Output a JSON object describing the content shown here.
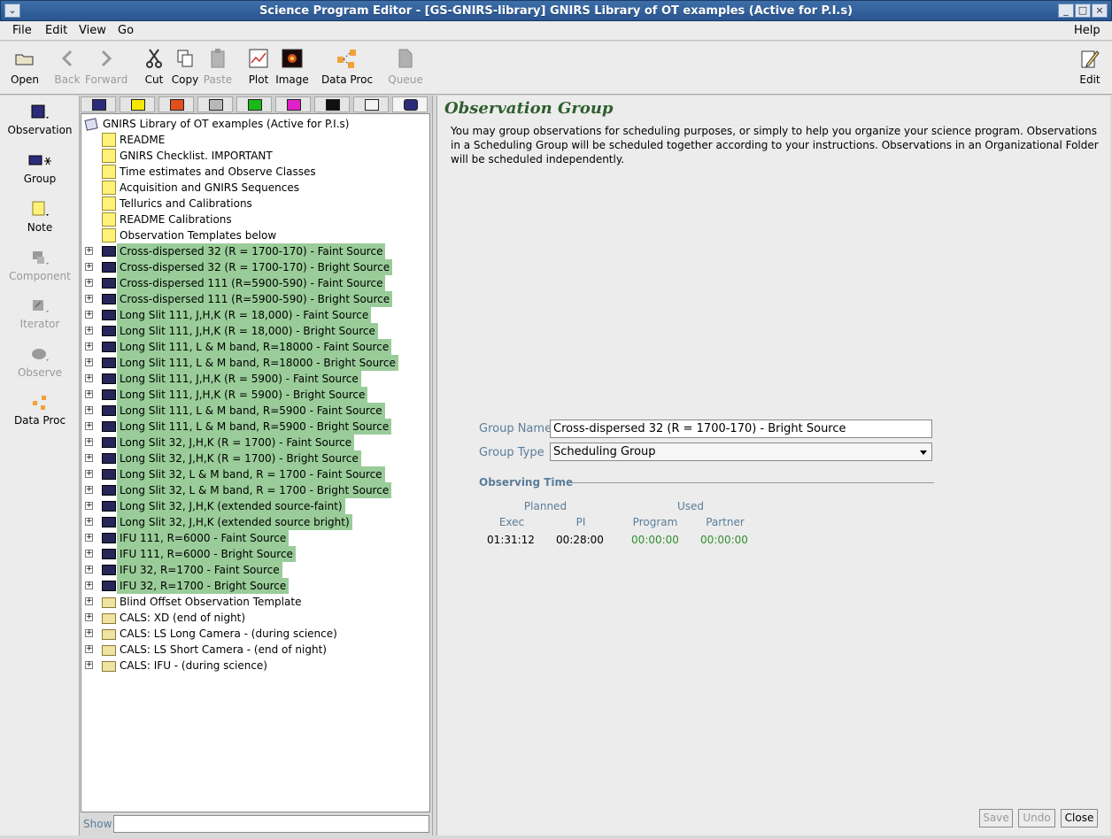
{
  "window": {
    "title": "Science Program Editor - [GS-GNIRS-library] GNIRS Library of OT examples (Active for P.I.s)"
  },
  "menu": {
    "file": "File",
    "edit": "Edit",
    "view": "View",
    "go": "Go",
    "help": "Help"
  },
  "toolbar": {
    "open": "Open",
    "back": "Back",
    "forward": "Forward",
    "cut": "Cut",
    "copy": "Copy",
    "paste": "Paste",
    "plot": "Plot",
    "image": "Image",
    "data_proc": "Data Proc",
    "queue": "Queue",
    "edit": "Edit"
  },
  "left_panel": {
    "observation": "Observation",
    "group": "Group",
    "note": "Note",
    "component": "Component",
    "iterator": "Iterator",
    "observe": "Observe",
    "data_proc": "Data Proc"
  },
  "tree": {
    "root": "GNIRS Library of OT examples (Active for P.I.s)",
    "notes": [
      "README",
      "GNIRS Checklist.  IMPORTANT",
      "Time estimates and Observe Classes",
      "Acquisition and GNIRS Sequences",
      "Tellurics and Calibrations",
      "README Calibrations",
      "Observation Templates below"
    ],
    "groups": [
      "Cross-dispersed 32 (R = 1700-170) - Faint Source",
      "Cross-dispersed 32 (R = 1700-170) - Bright Source",
      "Cross-dispersed 111 (R=5900-590) - Faint Source",
      "Cross-dispersed 111 (R=5900-590) - Bright Source",
      "Long Slit 111,  J,H,K (R = 18,000) - Faint Source",
      "Long Slit 111,  J,H,K (R = 18,000) - Bright Source",
      "Long Slit 111,  L & M band, R=18000 - Faint Source",
      "Long Slit 111,  L & M band, R=18000 - Bright Source",
      "Long Slit 111,  J,H,K (R = 5900) - Faint Source",
      "Long Slit 111,  J,H,K (R = 5900) - Bright Source",
      "Long Slit 111,  L & M band, R=5900 - Faint Source",
      "Long Slit 111,  L & M band, R=5900 - Bright Source",
      "Long Slit 32,  J,H,K (R = 1700) - Faint Source",
      "Long Slit 32,  J,H,K (R = 1700) - Bright Source",
      "Long Slit 32,  L & M band, R = 1700 - Faint Source",
      "Long Slit 32,  L & M band, R = 1700 - Bright Source",
      "Long Slit 32, J,H,K (extended source-faint)",
      "Long Slit 32, J,H,K (extended source bright)",
      "IFU 111, R=6000 - Faint Source",
      "IFU 111, R=6000 - Bright Source",
      "IFU 32, R=1700 - Faint Source",
      "IFU 32, R=1700 - Bright Source"
    ],
    "folders": [
      "Blind Offset Observation Template",
      "CALS: XD (end of night)",
      "CALS: LS Long Camera - (during science)",
      "CALS: LS Short Camera - (end of night)",
      "CALS: IFU - (during science)"
    ]
  },
  "show": {
    "label": "Show",
    "value": ""
  },
  "panel": {
    "title": "Observation Group",
    "description": "You may group observations for scheduling purposes, or simply to help you organize your science program. Observations in a Scheduling Group will be scheduled together according to your instructions. Observations in an Organizational Folder will be scheduled independently.",
    "group_name_label": "Group Name",
    "group_name_value": "Cross-dispersed 32 (R = 1700-170) - Bright Source",
    "group_type_label": "Group Type",
    "group_type_value": "Scheduling Group",
    "observing_time_label": "Observing Time",
    "planned": "Planned",
    "used": "Used",
    "exec": "Exec",
    "pi": "PI",
    "program": "Program",
    "partner": "Partner",
    "exec_value": "01:31:12",
    "pi_value": "00:28:00",
    "program_value": "00:00:00",
    "partner_value": "00:00:00"
  },
  "buttons": {
    "save": "Save",
    "undo": "Undo",
    "close": "Close"
  },
  "colors": {
    "highlight": "#99cc99",
    "title_green": "#2f5e2f",
    "label_blue": "#5a7d9a",
    "used_green": "#2f8f2f"
  }
}
